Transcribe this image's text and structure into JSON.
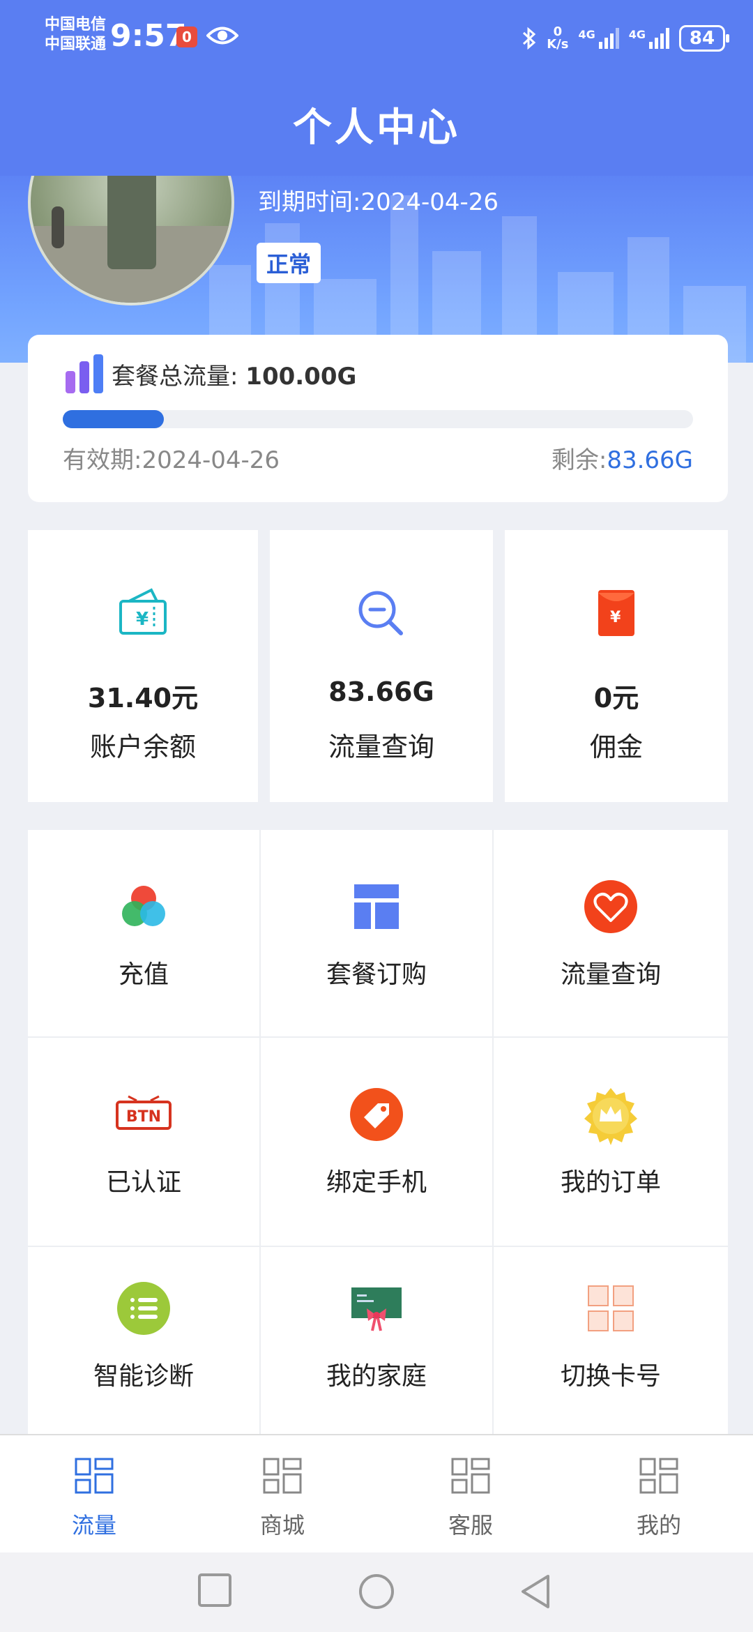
{
  "status_bar": {
    "carrier_1": "中国电信",
    "carrier_2": "中国联通",
    "time": "9:57",
    "notification_badge": "0",
    "net_speed_value": "0",
    "net_speed_unit": "K/s",
    "signal_1_label": "4G",
    "signal_2_label": "4G",
    "battery": "84"
  },
  "header": {
    "title": "个人中心"
  },
  "profile": {
    "expire_label": "到期时间:",
    "expire_date": "2024-04-26",
    "status": "正常"
  },
  "plan": {
    "total_label": "套餐总流量:",
    "total_value": "100.00G",
    "valid_label": "有效期:",
    "valid_date": "2024-04-26",
    "remain_label": "剩余:",
    "remain_value": "83.66G",
    "progress_fraction": 0.16
  },
  "stats": [
    {
      "value": "31.40元",
      "label": "账户余额",
      "icon": "wallet-icon"
    },
    {
      "value": "83.66G",
      "label": "流量查询",
      "icon": "search-minus-icon"
    },
    {
      "value": "0元",
      "label": "佣金",
      "icon": "red-envelope-icon"
    }
  ],
  "grid": [
    {
      "label": "充值",
      "icon": "color-circles-icon"
    },
    {
      "label": "套餐订购",
      "icon": "layout-icon"
    },
    {
      "label": "流量查询",
      "icon": "heart-icon"
    },
    {
      "label": "已认证",
      "icon": "btn-badge-icon"
    },
    {
      "label": "绑定手机",
      "icon": "tag-icon"
    },
    {
      "label": "我的订单",
      "icon": "crown-icon"
    },
    {
      "label": "智能诊断",
      "icon": "list-icon"
    },
    {
      "label": "我的家庭",
      "icon": "blackboard-icon"
    },
    {
      "label": "切换卡号",
      "icon": "grid-squares-icon"
    }
  ],
  "btn_badge_text": "BTN",
  "nav": [
    {
      "label": "流量",
      "active": true
    },
    {
      "label": "商城",
      "active": false
    },
    {
      "label": "客服",
      "active": false
    },
    {
      "label": "我的",
      "active": false
    }
  ],
  "colors": {
    "primary": "#5a7ef2",
    "accent_blue": "#2f6fe0",
    "inactive_gray": "#666666"
  }
}
